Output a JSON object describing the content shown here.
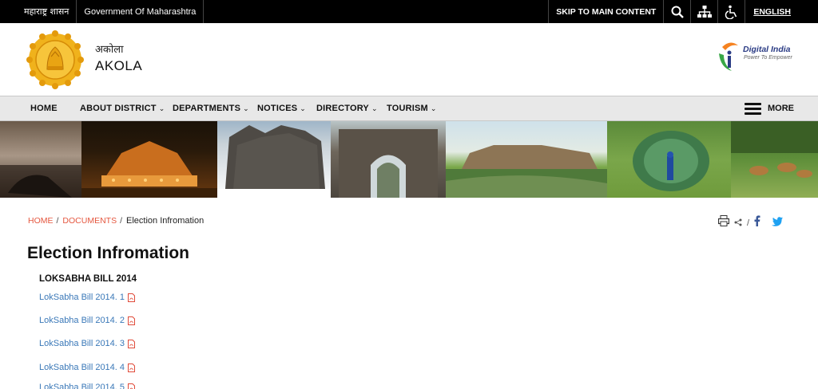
{
  "topbar": {
    "gov_marathi": "महाराष्ट्र शासन",
    "gov_english": "Government Of Maharashtra",
    "skip": "SKIP TO MAIN CONTENT",
    "language": "ENGLISH",
    "icons": [
      "search-icon",
      "sitemap-icon",
      "accessibility-icon"
    ]
  },
  "header": {
    "name_marathi": "अकोला",
    "name_english": "AKOLA",
    "digital_india_title": "Digital India",
    "digital_india_tagline": "Power To Empower"
  },
  "nav": {
    "items": [
      {
        "label": "HOME",
        "dropdown": false
      },
      {
        "label": "ABOUT DISTRICT",
        "dropdown": true
      },
      {
        "label": "DEPARTMENTS",
        "dropdown": true
      },
      {
        "label": "NOTICES",
        "dropdown": true
      },
      {
        "label": "DIRECTORY",
        "dropdown": true
      },
      {
        "label": "TOURISM",
        "dropdown": true
      }
    ],
    "more": "MORE"
  },
  "breadcrumb": {
    "home": "HOME",
    "documents": "DOCUMENTS",
    "current": "Election Infromation"
  },
  "page": {
    "title": "Election Infromation",
    "section": "LOKSABHA BILL 2014",
    "links": [
      "LokSabha Bill 2014. 1",
      "LokSabha Bill 2014. 2",
      "LokSabha Bill 2014. 3",
      "LokSabha Bill 2014. 4",
      "LokSabha Bill 2014. 5"
    ]
  },
  "colors": {
    "accent_link": "#3a78b8",
    "breadcrumb_link": "#e5573f",
    "topbar_bg": "#000000",
    "nav_bg": "#e8e8e8"
  }
}
